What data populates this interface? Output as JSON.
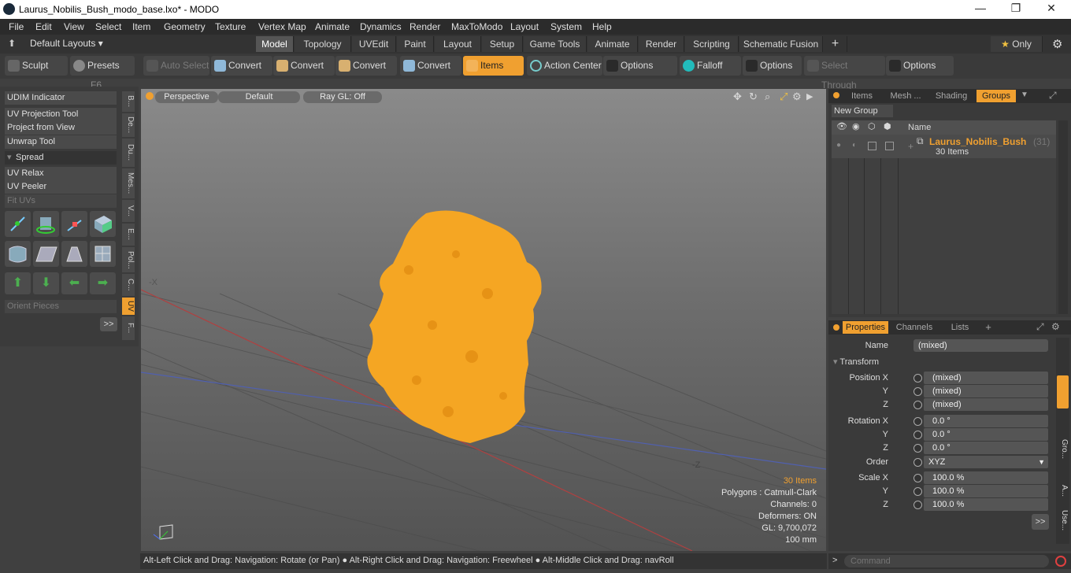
{
  "window": {
    "title": "Laurus_Nobilis_Bush_modo_base.lxo* - MODO"
  },
  "menu": [
    "File",
    "Edit",
    "View",
    "Select",
    "Item",
    "Geometry",
    "Texture",
    "Vertex Map",
    "Animate",
    "Dynamics",
    "Render",
    "MaxToModo",
    "Layout",
    "System",
    "Help"
  ],
  "layouts": {
    "label": "Default Layouts ▾"
  },
  "tabs": [
    "Model",
    "Topology",
    "UVEdit",
    "Paint",
    "Layout",
    "Setup",
    "Game Tools",
    "Animate",
    "Render",
    "Scripting",
    "Schematic Fusion",
    "+"
  ],
  "only_label": "Only",
  "toolbar": {
    "sculpt": "Sculpt",
    "presets": "Presets",
    "presets_key": "F6",
    "auto_select": "Auto Select",
    "convert1": "Convert",
    "convert2": "Convert",
    "convert3": "Convert",
    "convert4": "Convert",
    "items": "Items",
    "action_center": "Action Center",
    "options1": "Options",
    "falloff": "Falloff",
    "options2": "Options",
    "select_through": "Select Through",
    "options3": "Options"
  },
  "left": {
    "udim": "UDIM Indicator",
    "uv_projection": "UV Projection Tool",
    "project_view": "Project from View",
    "unwrap": "Unwrap Tool",
    "spread": "Spread",
    "uv_relax": "UV Relax",
    "uv_peeler": "UV Peeler",
    "fit_uvs": "Fit UVs",
    "orient": "Orient Pieces",
    "more": ">>",
    "vtabs": [
      "B...",
      "De...",
      "Du...",
      "Mes...",
      "V...",
      "E...",
      "Pol...",
      "C...",
      "UV",
      "F..."
    ]
  },
  "viewport": {
    "perspective": "Perspective",
    "default": "Default",
    "raygl": "Ray GL: Off",
    "axis_x": "-X",
    "axis_z": "-Z",
    "info": {
      "items": "30 Items",
      "polygons": "Polygons : Catmull-Clark",
      "channels": "Channels: 0",
      "deformers": "Deformers: ON",
      "gl": "GL: 9,700,072",
      "size": "100 mm"
    }
  },
  "groups_panel": {
    "tabs": [
      "Items",
      "Mesh ...",
      "Shading",
      "Groups"
    ],
    "new_group": "New Group",
    "name_col": "Name",
    "group_name": "Laurus_Nobilis_Bush",
    "group_count": "(31)",
    "group_items": "30 Items"
  },
  "properties": {
    "tabs": [
      "Properties",
      "Channels",
      "Lists",
      "+"
    ],
    "name_label": "Name",
    "name_value": "(mixed)",
    "transform": "Transform",
    "rows": [
      {
        "label": "Position X",
        "value": "(mixed)"
      },
      {
        "label": "Y",
        "value": "(mixed)"
      },
      {
        "label": "Z",
        "value": "(mixed)"
      },
      {
        "label": "Rotation X",
        "value": "0.0 °"
      },
      {
        "label": "Y",
        "value": "0.0 °"
      },
      {
        "label": "Z",
        "value": "0.0 °"
      },
      {
        "label": "Order",
        "value": "XYZ"
      },
      {
        "label": "Scale X",
        "value": "100.0 %"
      },
      {
        "label": "Y",
        "value": "100.0 %"
      },
      {
        "label": "Z",
        "value": "100.0 %"
      }
    ],
    "side_tabs": [
      "Gro...",
      "A...",
      "Use..."
    ],
    "more": ">>"
  },
  "status": {
    "text": "Alt-Left Click and Drag: Navigation: Rotate (or Pan) ● Alt-Right Click and Drag: Navigation: Freewheel ● Alt-Middle Click and Drag: navRoll"
  },
  "command": {
    "placeholder": "Command"
  },
  "colors": {
    "accent": "#f0a030",
    "foliage": "#f5a623"
  }
}
